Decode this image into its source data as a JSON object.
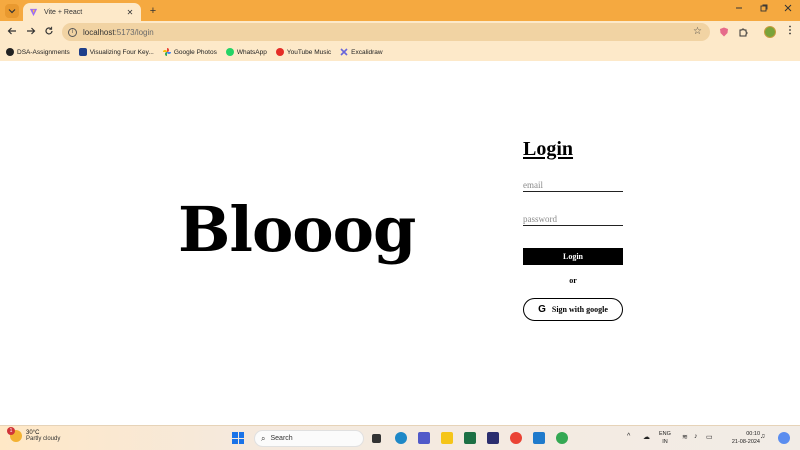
{
  "browser": {
    "tab_title": "Vite + React",
    "tab_close": "✕",
    "new_tab": "+",
    "url_host": "localhost",
    "url_path": ":5173/login",
    "bookmarks": [
      {
        "label": "DSA-Assignments",
        "icon": "github-icon",
        "color": "#222222"
      },
      {
        "label": "Visualizing Four Key...",
        "icon": "ja-icon",
        "color": "#1f3f8a"
      },
      {
        "label": "Google Photos",
        "icon": "google-photos-icon",
        "color": "#f2a900"
      },
      {
        "label": "WhatsApp",
        "icon": "whatsapp-icon",
        "color": "#25d366"
      },
      {
        "label": "YouTube Music",
        "icon": "youtube-music-icon",
        "color": "#e52d27"
      },
      {
        "label": "Excalidraw",
        "icon": "excalidraw-icon",
        "color": "#6965db"
      }
    ]
  },
  "page": {
    "brand": "Blooog",
    "login_title": "Login",
    "email_placeholder": "email",
    "password_placeholder": "password",
    "login_button": "Login",
    "or_text": "or",
    "google_button": "Sign with google",
    "google_glyph": "G"
  },
  "taskbar": {
    "temperature": "30°C",
    "condition": "Partly cloudy",
    "weather_badge": "1",
    "search_label": "Search",
    "lang_top": "ENG",
    "lang_bottom": "IN",
    "time": "00:10",
    "date": "21-08-2024"
  },
  "colors": {
    "accent": "#f5a940",
    "toolbar": "#fde9c9"
  }
}
